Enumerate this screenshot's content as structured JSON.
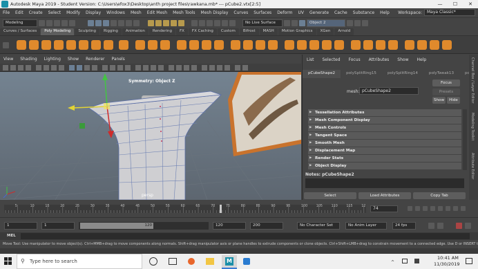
{
  "window": {
    "title": "Autodesk Maya 2019 - Student Version: C:\\Users\\efox3\\Desktop\\anth project files\\rawkana.mb* --- pCube2.vtx[2:5]",
    "minimize": "—",
    "maximize": "☐",
    "close": "✕"
  },
  "menubar": {
    "items": [
      "File",
      "Edit",
      "Create",
      "Select",
      "Modify",
      "Display",
      "Windows",
      "Mesh",
      "Edit Mesh",
      "Mesh Tools",
      "Mesh Display",
      "Curves",
      "Surfaces",
      "Deform",
      "UV",
      "Generate",
      "Cache",
      "Substance",
      "Help"
    ],
    "workspace_label": "Workspace:",
    "workspace_value": "Maya Classic*"
  },
  "statusline": {
    "mode": "Modeling",
    "live_surface": "No Live Surface",
    "symmetry": "Symmetry: Object Z",
    "object_field": "Object 2"
  },
  "shelf": {
    "tabs": [
      "Curves / Surfaces",
      "Poly Modeling",
      "Sculpting",
      "Rigging",
      "Animation",
      "Rendering",
      "FX",
      "FX Caching",
      "Custom",
      "Bifrost",
      "MASH",
      "Motion Graphics",
      "XGen",
      "Arnold"
    ],
    "active_tab": "Poly Modeling"
  },
  "viewport": {
    "menu": [
      "View",
      "Shading",
      "Lighting",
      "Show",
      "Renderer",
      "Panels"
    ],
    "symmetry_label": "Symmetry: Object Z",
    "camera_label": "persp"
  },
  "attribute_editor": {
    "top_menu": [
      "List",
      "Selected",
      "Focus",
      "Attributes",
      "Show",
      "Help"
    ],
    "tabs": [
      "pCubeShape2",
      "polySplitRing15",
      "polySplitRing14",
      "polyTweak13",
      "polySp"
    ],
    "active_tab": "pCubeShape2",
    "mesh_label": "mesh:",
    "mesh_value": "pCubeShape2",
    "buttons": {
      "focus": "Focus",
      "presets": "Presets",
      "show": "Show",
      "hide": "Hide"
    },
    "sections": [
      "Tessellation Attributes",
      "Mesh Component Display",
      "Mesh Controls",
      "Tangent Space",
      "Smooth Mesh",
      "Displacement Map",
      "Render Stats",
      "Object Display"
    ],
    "notes_label": "Notes: pCubeShape2",
    "footer_buttons": {
      "select": "Select",
      "load": "Load Attributes",
      "copy": "Copy Tab"
    }
  },
  "side_tabs": [
    "Channel Box / Layer Editor",
    "Modeling Toolkit",
    "Attribute Editor"
  ],
  "timeline": {
    "ticks": [
      "5",
      "10",
      "15",
      "20",
      "25",
      "30",
      "35",
      "40",
      "45",
      "50",
      "55",
      "60",
      "65",
      "70",
      "75",
      "80",
      "85",
      "90",
      "95",
      "100",
      "105",
      "110",
      "115",
      "12"
    ],
    "current_frame": "74"
  },
  "range": {
    "start": "1",
    "anim_start": "1",
    "range_value": "120",
    "range_end": "120",
    "anim_end": "200",
    "character_set": "No Character Set",
    "anim_layer": "No Anim Layer",
    "fps": "24 fps"
  },
  "mel": {
    "label": "MEL"
  },
  "help_line": "Move Tool: Use manipulator to move object(s). Ctrl+MMB+drag to move components along normals. Shift+drag manipulator axis or plane handles to extrude components or clone objects. Ctrl+Shift+LMB+drag to constrain movement to a connected edge. Use D or INSERT to chang",
  "taskbar": {
    "search_placeholder": "Type here to search",
    "time": "10:41 AM",
    "date": "11/30/2019"
  }
}
